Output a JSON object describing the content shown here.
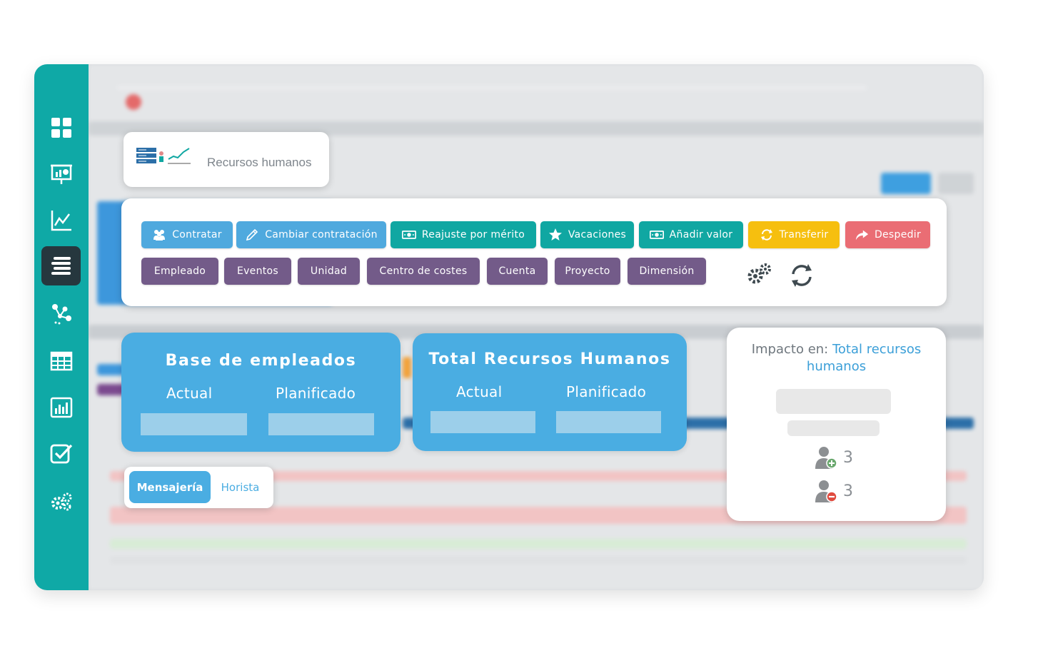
{
  "colors": {
    "sidebar": "#0fa9a6",
    "accent_blue": "#4aade2",
    "teal": "#10a7a2",
    "yellow": "#f6bf0f",
    "red": "#ea6d74",
    "purple": "#735b89"
  },
  "sidebar": {
    "items": [
      {
        "icon": "dashboard-grid-icon",
        "active": false
      },
      {
        "icon": "presentation-chart-icon",
        "active": false
      },
      {
        "icon": "line-chart-icon",
        "active": false
      },
      {
        "icon": "stacked-layers-icon",
        "active": true
      },
      {
        "icon": "workflow-nodes-icon",
        "active": false
      },
      {
        "icon": "table-grid-icon",
        "active": false
      },
      {
        "icon": "bar-report-icon",
        "active": false
      },
      {
        "icon": "checklist-icon",
        "active": false
      },
      {
        "icon": "settings-gears-icon",
        "active": false
      }
    ]
  },
  "header": {
    "logo_icon": "hr-logo-icon",
    "title": "Recursos humanos"
  },
  "actions": {
    "row1": [
      {
        "label": "Contratar",
        "icon": "people-icon",
        "color": "blue"
      },
      {
        "label": "Cambiar contratación",
        "icon": "pencil-icon",
        "color": "blue"
      },
      {
        "label": "Reajuste por mérito",
        "icon": "money-icon",
        "color": "teal"
      },
      {
        "label": "Vacaciones",
        "icon": "star-icon",
        "color": "teal"
      },
      {
        "label": "Añadir valor",
        "icon": "money-icon",
        "color": "teal"
      },
      {
        "label": "Transferir",
        "icon": "transfer-icon",
        "color": "yellow"
      },
      {
        "label": "Despedir",
        "icon": "share-arrow-icon",
        "color": "red"
      }
    ],
    "row2": [
      "Empleado",
      "Eventos",
      "Unidad",
      "Centro de costes",
      "Cuenta",
      "Proyecto",
      "Dimensión"
    ],
    "tools": [
      "settings-gears-icon",
      "refresh-icon"
    ]
  },
  "stats": {
    "base": {
      "title": "Base de empleados",
      "actual": "Actual",
      "planned": "Planificado"
    },
    "total": {
      "title": "Total Recursos Humanos",
      "actual": "Actual",
      "planned": "Planificado"
    }
  },
  "tabs": {
    "active": "Mensajería",
    "inactive": "Horista"
  },
  "impact": {
    "label": "Impacto en: ",
    "target": "Total recursos humanos",
    "added": "3",
    "removed": "3"
  }
}
